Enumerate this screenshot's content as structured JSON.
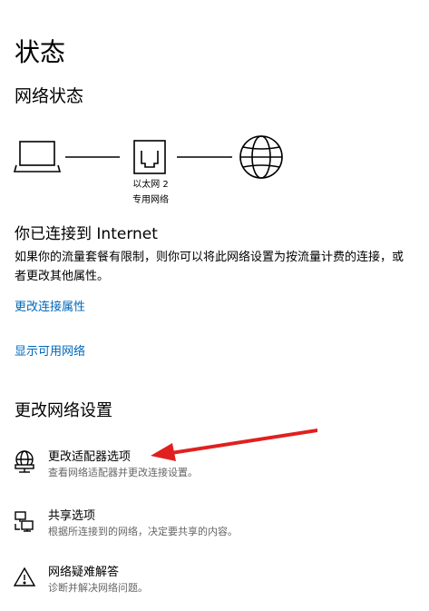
{
  "page": {
    "title": "状态"
  },
  "network_status": {
    "heading": "网络状态",
    "adapter_name": "以太网 2",
    "network_profile": "专用网络",
    "icons": [
      "laptop-icon",
      "ethernet-port-icon",
      "globe-icon"
    ]
  },
  "connection": {
    "title": "你已连接到 Internet",
    "description": "如果你的流量套餐有限制，则你可以将此网络设置为按流量计费的连接，或者更改其他属性。",
    "links": {
      "change_properties": "更改连接属性",
      "show_networks": "显示可用网络"
    }
  },
  "change_settings": {
    "heading": "更改网络设置",
    "options": [
      {
        "title": "更改适配器选项",
        "subtitle": "查看网络适配器并更改连接设置。",
        "icon": "adapter-globe-icon"
      },
      {
        "title": "共享选项",
        "subtitle": "根据所连接到的网络，决定要共享的内容。",
        "icon": "sharing-icon"
      },
      {
        "title": "网络疑难解答",
        "subtitle": "诊断并解决网络问题。",
        "icon": "warning-icon"
      }
    ]
  },
  "colors": {
    "link": "#0067b8",
    "annotation_arrow": "#e02020",
    "text": "#000000",
    "secondary_text": "#666666"
  }
}
